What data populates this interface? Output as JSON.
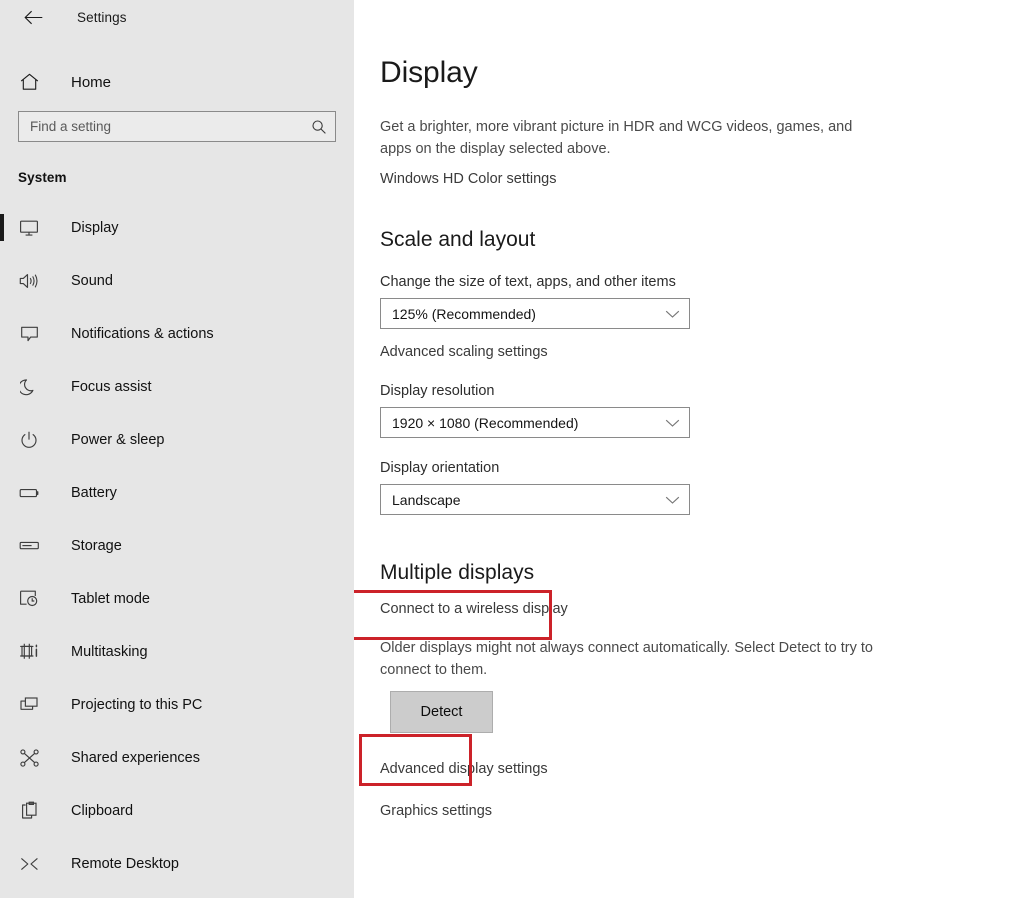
{
  "window": {
    "title": "Settings",
    "back_icon": "arrow-left-icon"
  },
  "sidebar": {
    "home_label": "Home",
    "home_icon": "home-icon",
    "search": {
      "placeholder": "Find a setting",
      "value": "",
      "icon": "search-icon"
    },
    "section_title": "System",
    "items": [
      {
        "label": "Display",
        "icon": "monitor-icon",
        "active": true
      },
      {
        "label": "Sound",
        "icon": "speaker-icon",
        "active": false
      },
      {
        "label": "Notifications & actions",
        "icon": "notification-icon",
        "active": false
      },
      {
        "label": "Focus assist",
        "icon": "moon-icon",
        "active": false
      },
      {
        "label": "Power & sleep",
        "icon": "power-icon",
        "active": false
      },
      {
        "label": "Battery",
        "icon": "battery-icon",
        "active": false
      },
      {
        "label": "Storage",
        "icon": "storage-icon",
        "active": false
      },
      {
        "label": "Tablet mode",
        "icon": "tablet-mode-icon",
        "active": false
      },
      {
        "label": "Multitasking",
        "icon": "multitasking-icon",
        "active": false
      },
      {
        "label": "Projecting to this PC",
        "icon": "projecting-icon",
        "active": false
      },
      {
        "label": "Shared experiences",
        "icon": "share-icon",
        "active": false
      },
      {
        "label": "Clipboard",
        "icon": "clipboard-icon",
        "active": false
      },
      {
        "label": "Remote Desktop",
        "icon": "remote-desktop-icon",
        "active": false
      }
    ]
  },
  "main": {
    "page_title": "Display",
    "hdr_description": "Get a brighter, more vibrant picture in HDR and WCG videos, games, and apps on the display selected above.",
    "hd_color_link": "Windows HD Color settings",
    "scale_and_layout": {
      "heading": "Scale and layout",
      "scale_label": "Change the size of text, apps, and other items",
      "scale_value": "125% (Recommended)",
      "advanced_scaling_link": "Advanced scaling settings",
      "resolution_label": "Display resolution",
      "resolution_value": "1920 × 1080 (Recommended)",
      "orientation_label": "Display orientation",
      "orientation_value": "Landscape"
    },
    "multiple_displays": {
      "heading": "Multiple displays",
      "wireless_link": "Connect to a wireless display",
      "detect_description": "Older displays might not always connect automatically. Select Detect to try to connect to them.",
      "detect_button": "Detect"
    },
    "advanced_display_link": "Advanced display settings",
    "graphics_settings_link": "Graphics settings"
  },
  "annotations": {
    "color": "#cc2229",
    "highlighted": [
      "Multiple displays",
      "Detect"
    ]
  }
}
